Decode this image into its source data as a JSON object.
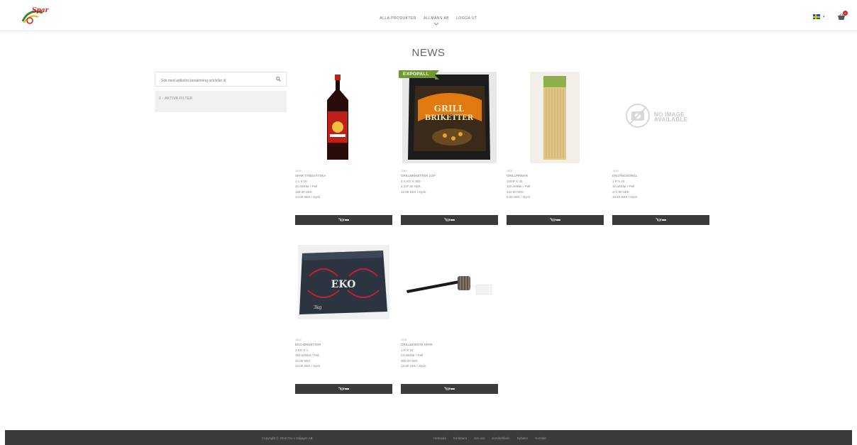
{
  "header": {
    "logo_text": "Spar",
    "nav": [
      {
        "label": "ALLA PRODUKTER"
      },
      {
        "label": "ALLMÄNS AB"
      },
      {
        "label": "LOGGA UT"
      }
    ],
    "cart_count": "0"
  },
  "page": {
    "title": "NEWS"
  },
  "sidebar": {
    "search_placeholder": "Sök med artikelns benämning och/eller id",
    "filter_label": "0 - AKTIVA FILTER"
  },
  "products": [
    {
      "id": "1676",
      "name": "SPAR TÄNDVÄTSKA",
      "pack": "1 L X 15",
      "per_pall": "40 artiklar / Pall",
      "price": "168.00 SEK",
      "unit_price": "14.00 SEK / styck",
      "image": "lighter-fluid-bottle"
    },
    {
      "id": "1180",
      "name": "GRILLBRIKETTER 1/1p",
      "pack": "3 X KG X 350",
      "per_pall": "",
      "price": "4.237.50 SEK",
      "unit_price": "16.95 SEK / styck",
      "image": "charcoal-bag",
      "badge": "EXPOPALL"
    },
    {
      "id": "1501",
      "name": "GRILLPINNAR",
      "pack": "100-P X 34",
      "per_pall": "110 artiklar / Pall",
      "price": "102.00 SEK",
      "unit_price": "4.25 SEK / styck",
      "image": "skewers-pack"
    },
    {
      "id": "1400",
      "name": "ENGÅNGSGRILL",
      "pack": "1-P X 34",
      "per_pall": "12 artiklar / Pall",
      "price": "372.00 SEK",
      "unit_price": "15.60 SEK / styck",
      "image": "no-image"
    },
    {
      "id": "1507",
      "name": "EKO-BRIKETTER",
      "pack": "3 KG X 1",
      "per_pall": "160 artiklar / Pall",
      "price": "33.00 SEK",
      "unit_price": "33.00 SEK / styck",
      "image": "eko-box"
    },
    {
      "id": "1531",
      "name": "GRILLBORSTE SPAR",
      "pack": "1-P X 24",
      "per_pall": "24 artiklar / Pall",
      "price": "300.00 SEK",
      "unit_price": "12.50 SEK / styck",
      "image": "grill-brush"
    }
  ],
  "no_image_text": {
    "line1": "NO IMAGE",
    "line2": "AVAILABLE"
  },
  "footer": {
    "copyright": "Copyright © 2018 Drv x Säljager AB",
    "links": [
      {
        "label": "Hemsida"
      },
      {
        "label": "Sortiment"
      },
      {
        "label": "Om oss"
      },
      {
        "label": "Kundartikeln"
      },
      {
        "label": "Nyheter"
      },
      {
        "label": "Kontakt"
      }
    ]
  },
  "colors": {
    "accent_green": "#6f9a2b",
    "button_dark": "#3b3b3b",
    "brand_red": "#d21f1f"
  }
}
